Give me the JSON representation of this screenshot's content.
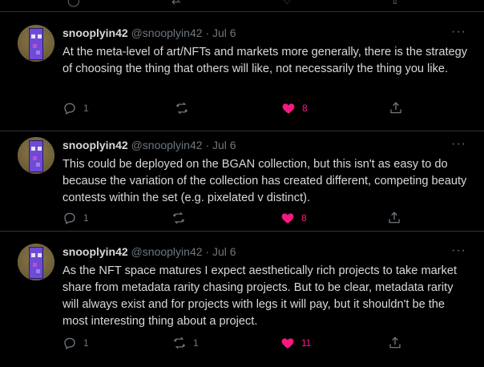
{
  "colors": {
    "background": "#000000",
    "text": "#d9d9d9",
    "muted": "#6e767d",
    "divider": "#2f3336",
    "like": "#f91880"
  },
  "tweets": [
    {
      "name": "snooplyin42",
      "handle": "@snooplyin42",
      "dot": "·",
      "date": "Jul 6",
      "more": "···",
      "text": "At the meta-level of art/NFTs and markets more generally, there is the strategy of choosing the thing that others will like, not necessarily the thing you like.",
      "replies": "1",
      "retweets": "",
      "likes": "8",
      "liked": true
    },
    {
      "name": "snooplyin42",
      "handle": "@snooplyin42",
      "dot": "·",
      "date": "Jul 6",
      "more": "···",
      "text": "This could be deployed on the BGAN collection, but this isn't as easy to do because the variation of the collection has created different, competing beauty contests within the set (e.g. pixelated v distinct).",
      "replies": "1",
      "retweets": "",
      "likes": "8",
      "liked": true
    },
    {
      "name": "snooplyin42",
      "handle": "@snooplyin42",
      "dot": "·",
      "date": "Jul 6",
      "more": "···",
      "text": "As the NFT space matures I expect aesthetically rich projects to take market share from metadata rarity chasing projects. But to be clear, metadata rarity will always exist and for projects with legs it will pay, but it shouldn't be the most interesting thing about a project.",
      "replies": "1",
      "retweets": "1",
      "likes": "11",
      "liked": true
    }
  ],
  "icons": {
    "reply": "reply-icon",
    "retweet": "retweet-icon",
    "like": "heart-icon",
    "share": "share-icon",
    "more": "more-icon"
  }
}
